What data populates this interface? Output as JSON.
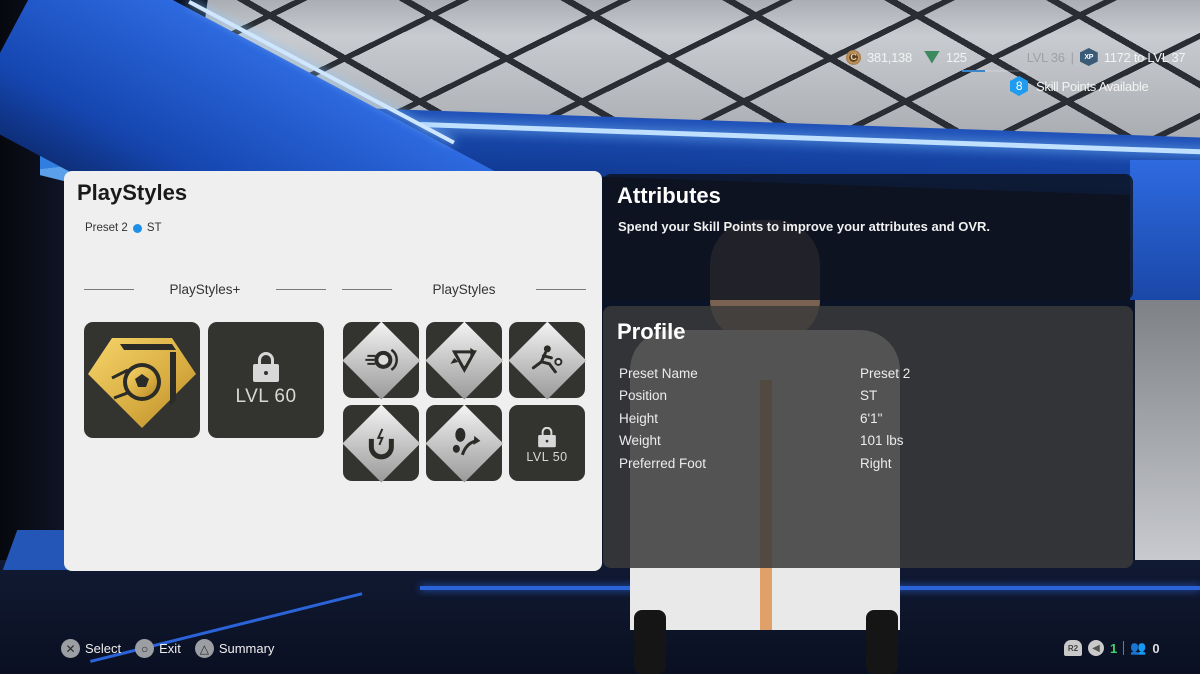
{
  "hud": {
    "coins": "381,138",
    "points": "125",
    "current_level": "LVL 36",
    "separator": "|",
    "xp_icon_label": "XP",
    "xp_to_next": "1172 to LVL 37",
    "xp_progress_fraction": 0.35,
    "skill_points_count": "8",
    "skill_points_label": "Skill Points Available",
    "coin_icon_label": "C"
  },
  "playstyles": {
    "title": "PlayStyles",
    "preset": "Preset 2",
    "position": "ST",
    "accent_color": "#1e8fe6",
    "plus_section": {
      "label": "PlayStyles+",
      "tiles": [
        {
          "name": "finesse-shot-plus",
          "locked": false
        },
        {
          "name": "locked-slot",
          "locked": true,
          "lock_label": "LVL 60"
        }
      ]
    },
    "section": {
      "label": "PlayStyles",
      "tiles": [
        {
          "name": "power-shot",
          "locked": false
        },
        {
          "name": "tiki-taka",
          "locked": false
        },
        {
          "name": "acrobatic",
          "locked": false
        },
        {
          "name": "press-proven",
          "locked": false
        },
        {
          "name": "quick-step",
          "locked": false
        },
        {
          "name": "locked-slot",
          "locked": true,
          "lock_label": "LVL 50"
        }
      ]
    }
  },
  "attributes": {
    "title": "Attributes",
    "subtitle": "Spend your Skill Points to improve your attributes and OVR."
  },
  "profile": {
    "title": "Profile",
    "rows": [
      {
        "label": "Preset Name",
        "value": "Preset 2"
      },
      {
        "label": "Position",
        "value": "ST"
      },
      {
        "label": "Height",
        "value": "6'1\""
      },
      {
        "label": "Weight",
        "value": "101 lbs"
      },
      {
        "label": "Preferred Foot",
        "value": "Right"
      }
    ]
  },
  "controls": [
    {
      "icon": "cross-button",
      "glyph": "✕",
      "label": "Select"
    },
    {
      "icon": "circle-button",
      "glyph": "○",
      "label": "Exit"
    },
    {
      "icon": "triangle-button",
      "glyph": "△",
      "label": "Summary"
    }
  ],
  "status": {
    "r2_label": "R2",
    "speaker_glyph": "◀",
    "voice_count": "1",
    "party_count": "0"
  }
}
